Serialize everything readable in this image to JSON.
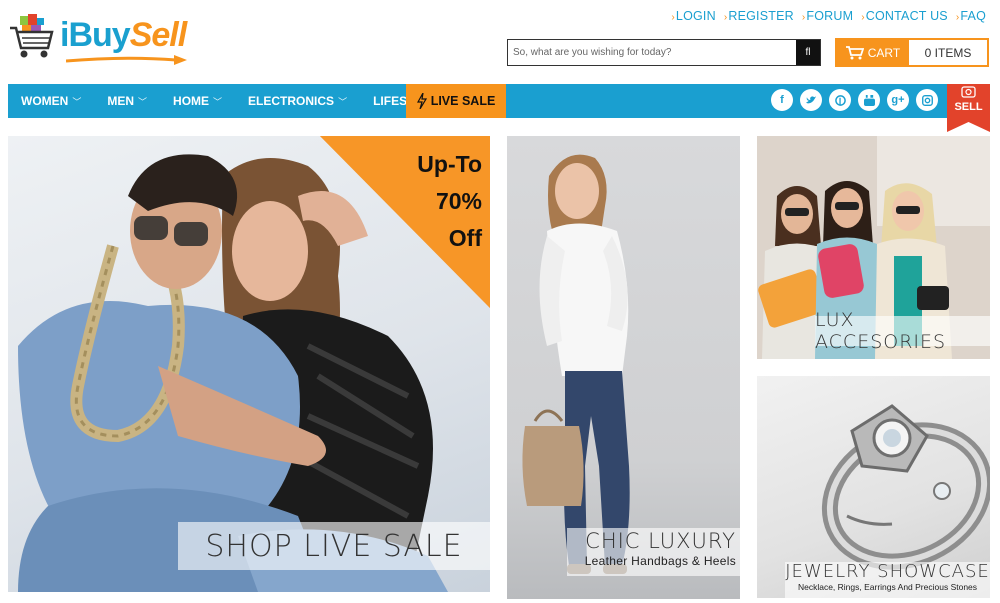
{
  "brand": {
    "part1": "iBuy",
    "part2": "Sell"
  },
  "toplinks": [
    {
      "label": "LOGIN"
    },
    {
      "label": "REGISTER"
    },
    {
      "label": "FORUM"
    },
    {
      "label": "CONTACT US"
    },
    {
      "label": "FAQ"
    }
  ],
  "search": {
    "placeholder": "So, what are you wishing for today?",
    "button_glyph": "fl"
  },
  "cart": {
    "label": "CART",
    "items": "0 ITEMS"
  },
  "nav": {
    "items": [
      {
        "label": "WOMEN"
      },
      {
        "label": "MEN"
      },
      {
        "label": "HOME"
      },
      {
        "label": "ELECTRONICS"
      },
      {
        "label": "LIFESTYLE"
      }
    ],
    "live_sale": "LIVE SALE",
    "sell": "SELL"
  },
  "socials": [
    "facebook-icon",
    "twitter-icon",
    "pinterest-icon",
    "youtube-icon",
    "google-plus-icon",
    "instagram-icon"
  ],
  "tiles": {
    "main": {
      "promo_line1": "Up-To",
      "promo_line2": "70%",
      "promo_line3": "Off",
      "caption": "SHOP LIVE SALE"
    },
    "chic": {
      "title": "CHIC LUXURY",
      "subtitle": "Leather Handbags & Heels"
    },
    "lux": {
      "title": "LUX ACCESORIES"
    },
    "jewel": {
      "title": "JEWELRY SHOWCASE",
      "subtitle": "Necklace, Rings, Earrings And Precious Stones"
    }
  },
  "colors": {
    "brand_blue": "#1a9fd0",
    "brand_orange": "#f7941d",
    "sell_red": "#e2432b"
  }
}
